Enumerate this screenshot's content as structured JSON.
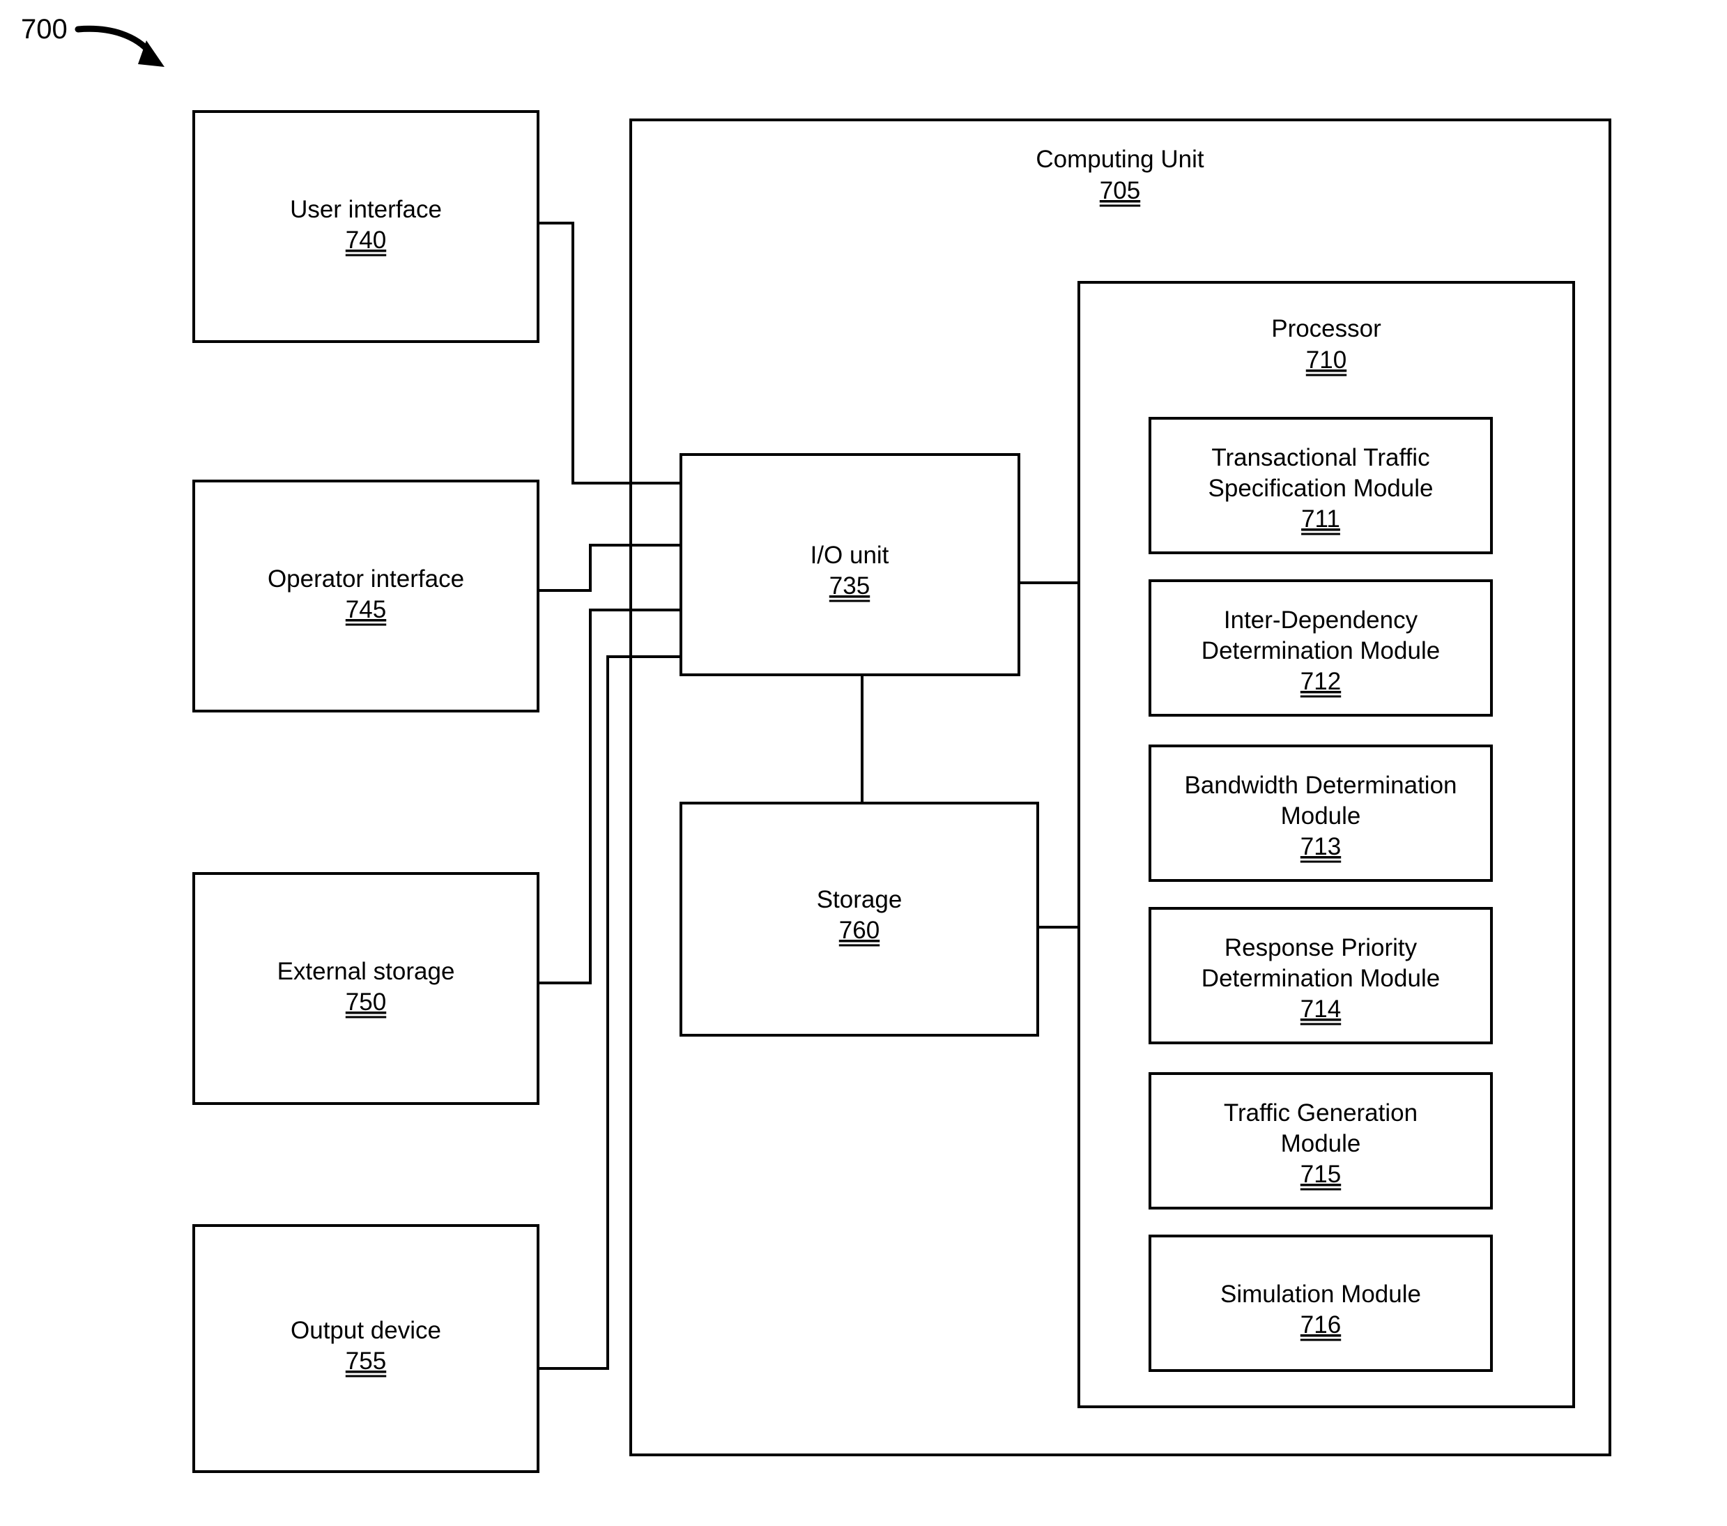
{
  "figure": {
    "label": "700",
    "type": "patent-block-diagram"
  },
  "computing_unit": {
    "title": "Computing Unit",
    "ref": "705"
  },
  "processor": {
    "title": "Processor",
    "ref": "710",
    "modules": [
      {
        "title_line1": "Transactional Traffic",
        "title_line2": "Specification Module",
        "ref": "711"
      },
      {
        "title_line1": "Inter-Dependency",
        "title_line2": "Determination Module",
        "ref": "712"
      },
      {
        "title_line1": "Bandwidth Determination",
        "title_line2": "Module",
        "ref": "713"
      },
      {
        "title_line1": "Response Priority",
        "title_line2": "Determination Module",
        "ref": "714"
      },
      {
        "title_line1": "Traffic Generation",
        "title_line2": "Module",
        "ref": "715"
      },
      {
        "title_line1": "Simulation Module",
        "title_line2": "",
        "ref": "716"
      }
    ]
  },
  "io_unit": {
    "title": "I/O unit",
    "ref": "735"
  },
  "storage": {
    "title": "Storage",
    "ref": "760"
  },
  "peripherals": [
    {
      "title": "User interface",
      "ref": "740"
    },
    {
      "title": "Operator interface",
      "ref": "745"
    },
    {
      "title": "External storage",
      "ref": "750"
    },
    {
      "title": "Output device",
      "ref": "755"
    }
  ],
  "colors": {
    "stroke": "#000000",
    "fill": "#ffffff",
    "background": "#ffffff"
  }
}
